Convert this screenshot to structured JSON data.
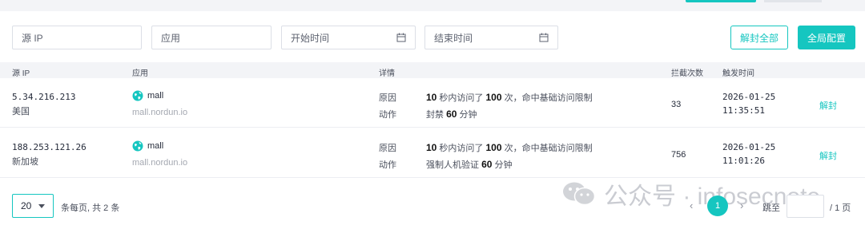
{
  "colors": {
    "accent": "#15c6c0",
    "header_bg": "#f3f4f7"
  },
  "filters": {
    "source_ip_placeholder": "源 IP",
    "app_placeholder": "应用",
    "start_time_placeholder": "开始时间",
    "end_time_placeholder": "结束时间"
  },
  "actions": {
    "unblock_all": "解封全部",
    "global_config": "全局配置"
  },
  "table": {
    "headers": {
      "source_ip": "源 IP",
      "app": "应用",
      "detail": "详情",
      "block_count": "拦截次数",
      "trigger_time": "触发时间"
    },
    "rows": [
      {
        "ip": "5.34.216.213",
        "country": "美国",
        "app_name": "mall",
        "app_host": "mall.nordun.io",
        "app_icon": "globe-icon",
        "label_reason": "原因",
        "label_action": "动作",
        "reason_seconds": "10",
        "reason_t1": "秒内访问了",
        "reason_hits": "100",
        "reason_t2": "次，命中基础访问限制",
        "action_t1": "封禁",
        "action_minutes": "60",
        "action_t2": "分钟",
        "count": "33",
        "date": "2026-01-25",
        "time": "11:35:51",
        "unblock": "解封"
      },
      {
        "ip": "188.253.121.26",
        "country": "新加坡",
        "app_name": "mall",
        "app_host": "mall.nordun.io",
        "app_icon": "globe-icon",
        "label_reason": "原因",
        "label_action": "动作",
        "reason_seconds": "10",
        "reason_t1": "秒内访问了",
        "reason_hits": "100",
        "reason_t2": "次，命中基础访问限制",
        "action_t1": "强制人机验证",
        "action_minutes": "60",
        "action_t2": "分钟",
        "count": "756",
        "date": "2026-01-25",
        "time": "11:01:26",
        "unblock": "解封"
      }
    ]
  },
  "pagination": {
    "page_size": "20",
    "info": "条每页, 共 2 条",
    "prev": "‹",
    "current": "1",
    "next": "›",
    "jump_label": "跳至",
    "jump_value": "",
    "total_pages": "/ 1 页"
  },
  "watermark": {
    "text": "公众号 · infosecnote"
  }
}
